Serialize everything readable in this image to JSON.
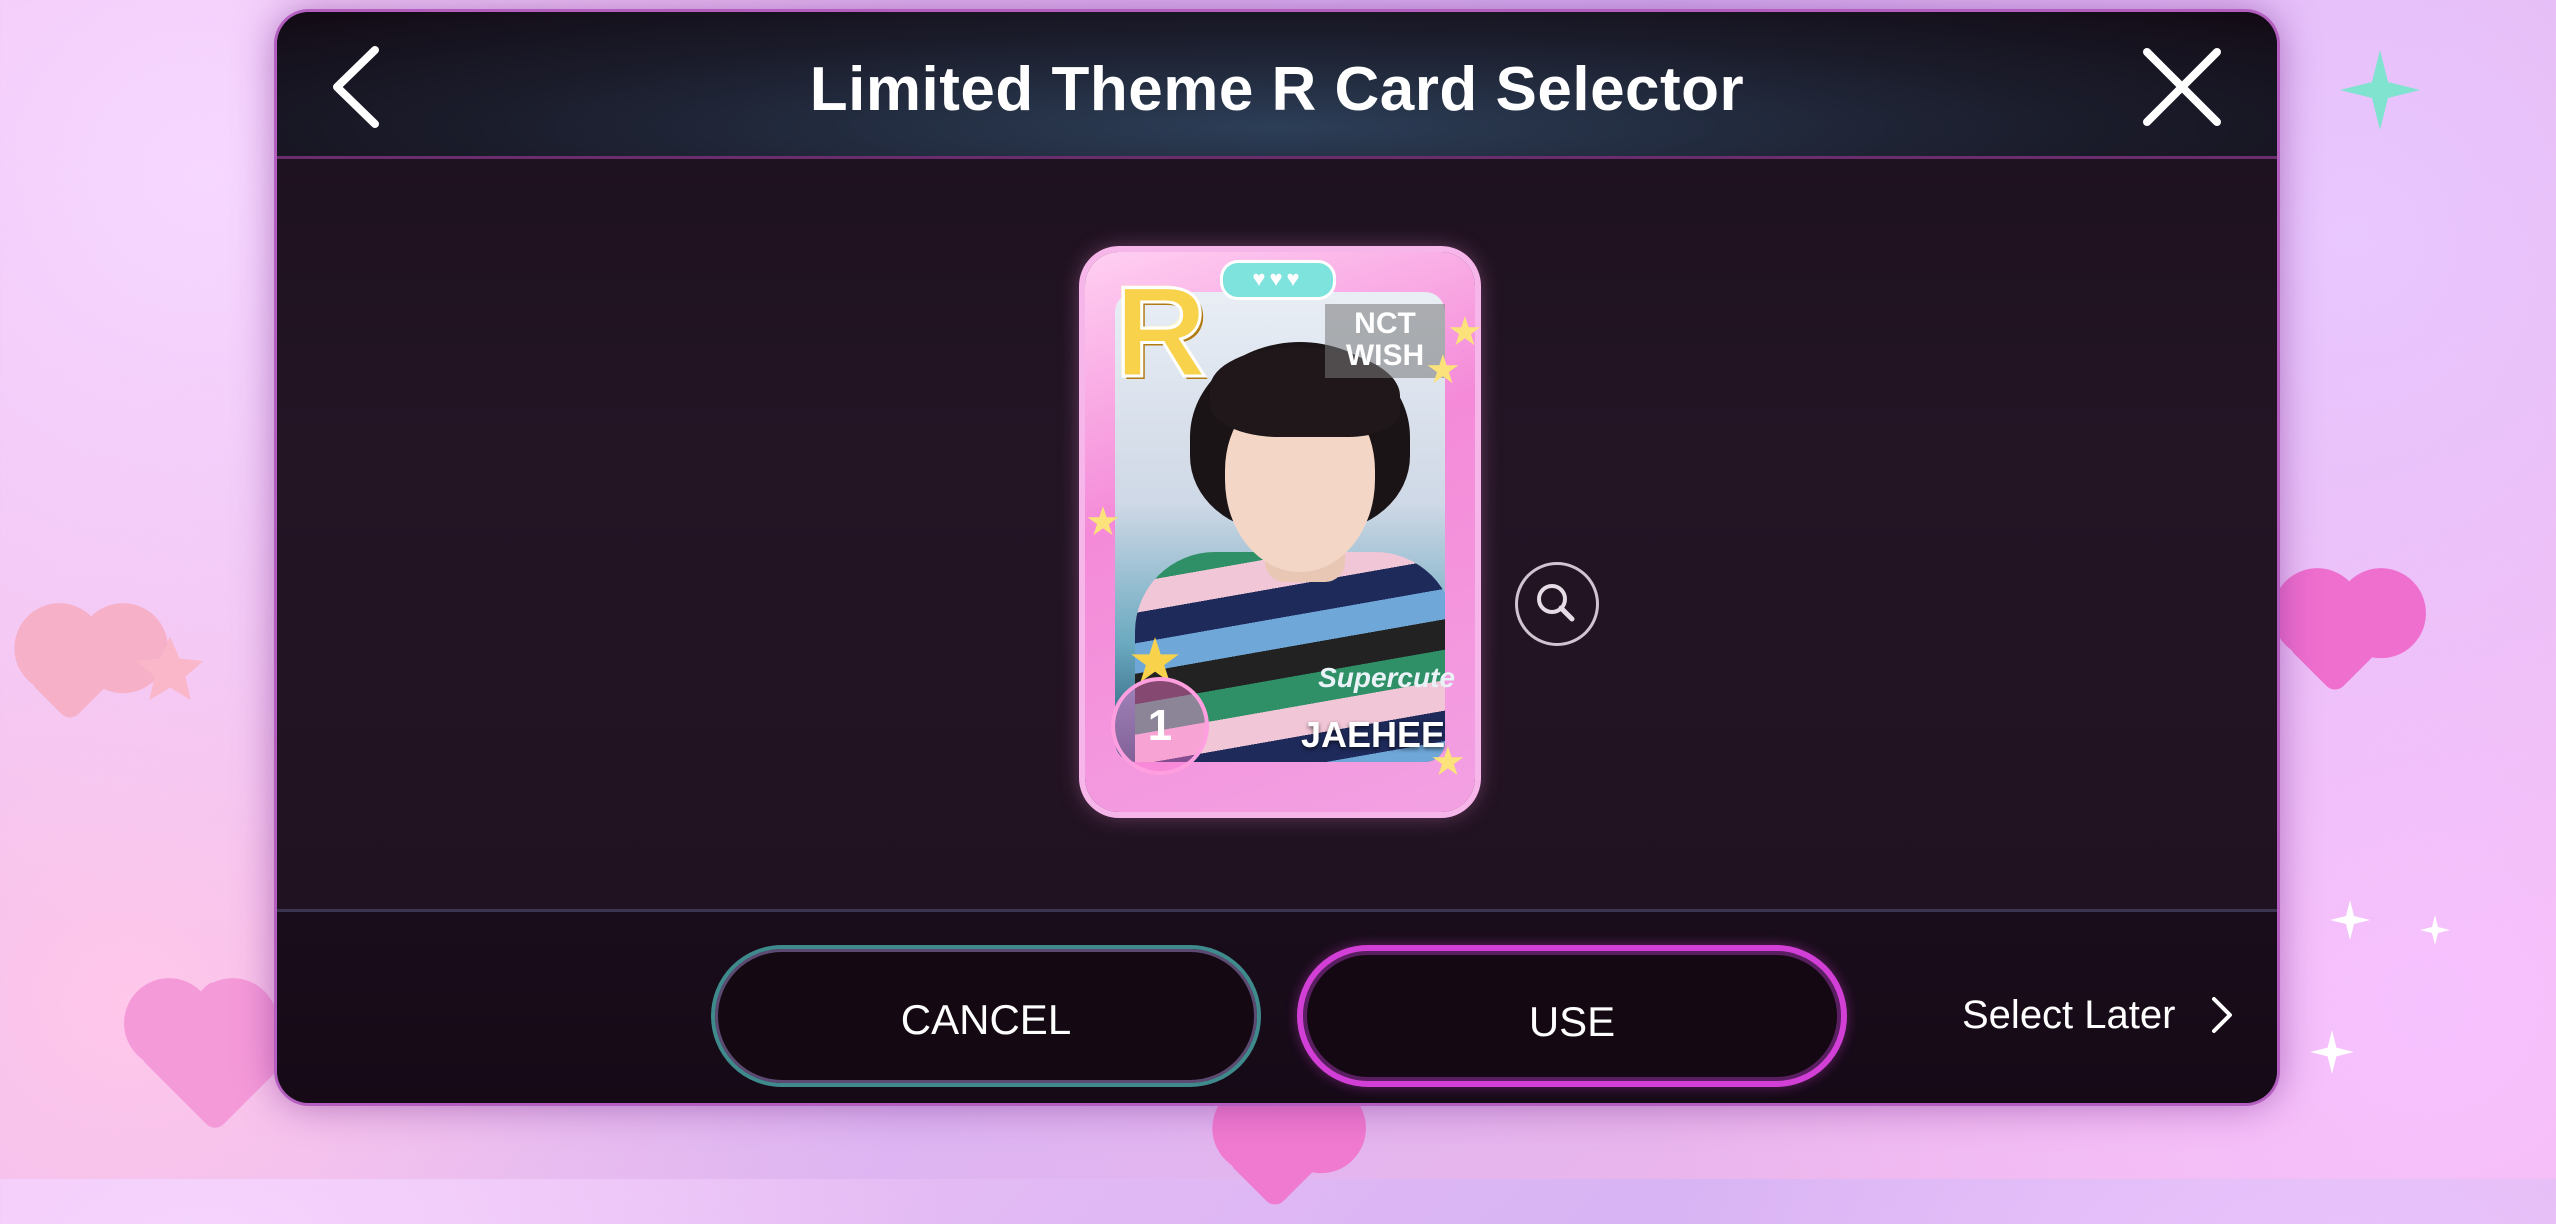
{
  "dialog": {
    "title": "Limited Theme R Card Selector",
    "back_icon": "chevron-left-icon",
    "close_icon": "close-icon"
  },
  "card": {
    "rarity": "R",
    "group": "NCT WISH",
    "group_line1": "NCT",
    "group_line2": "WISH",
    "type": "Supercute",
    "member": "JAEHEE",
    "rank": "1",
    "hearts": "♥♥♥",
    "zoom_icon": "magnifier-icon"
  },
  "actions": {
    "cancel_label": "CANCEL",
    "use_label": "USE",
    "select_later_label": "Select Later"
  },
  "colors": {
    "modal_border": "#b45fc0",
    "use_border": "#d23fd6",
    "cancel_border": "#3f8a8c",
    "card_frame": "#f48ad8",
    "rarity_gold": "#f8d24a"
  }
}
